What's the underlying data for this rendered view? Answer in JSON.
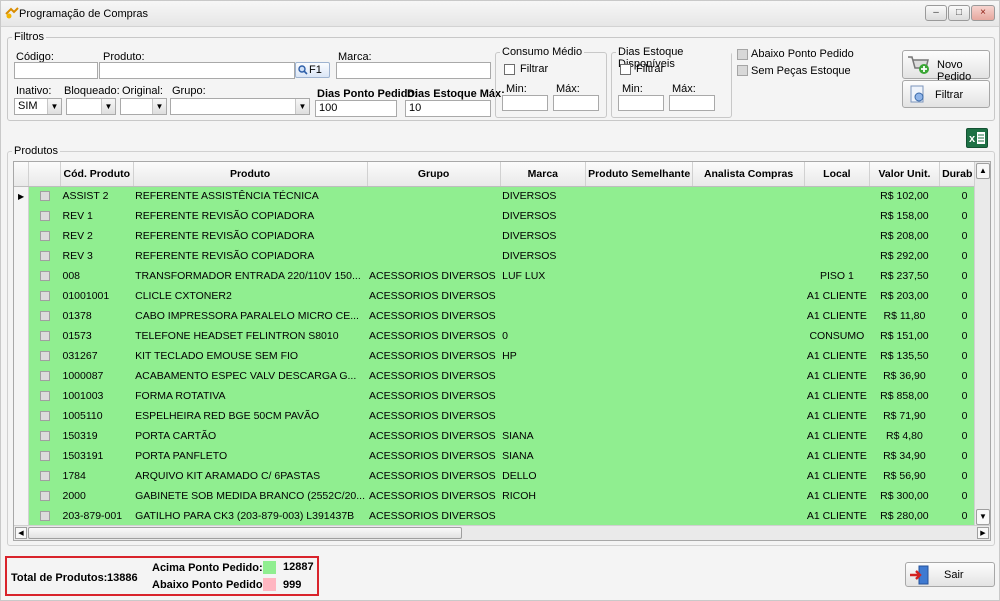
{
  "window": {
    "title": "Programação de Compras",
    "min": "–",
    "max": "□",
    "close": "×"
  },
  "filtros": {
    "legend": "Filtros",
    "codigo_label": "Código:",
    "produto_label": "Produto:",
    "marca_label": "Marca:",
    "f1_label": "F1",
    "inativo_label": "Inativo:",
    "inativo_value": "SIM",
    "bloqueado_label": "Bloqueado:",
    "original_label": "Original:",
    "grupo_label": "Grupo:",
    "dias_ponto_label": "Dias Ponto Pedido:",
    "dias_ponto_value": "100",
    "dias_estoque_label": "Dias Estoque Máx:",
    "dias_estoque_value": "10",
    "consumo_legend": "Consumo Médio",
    "consumo_filtrar": "Filtrar",
    "consumo_min": "Min:",
    "consumo_max": "Máx:",
    "dias_disp_legend": "Dias Estoque Disponíveis",
    "dias_disp_filtrar": "Filtrar",
    "dias_disp_min": "Min:",
    "dias_disp_max": "Máx:",
    "abaixo_ponto": "Abaixo Ponto Pedido",
    "sem_pecas": "Sem Peças Estoque"
  },
  "buttons": {
    "novo_pedido": "Novo Pedido",
    "filtrar": "Filtrar",
    "sair": "Sair",
    "excel": "x"
  },
  "produtos": {
    "legend": "Produtos",
    "columns": [
      "Cód. Produto",
      "Produto",
      "Grupo",
      "Marca",
      "Produto Semelhante",
      "Analista Compras",
      "Local",
      "Valor Unit.",
      "Durab"
    ],
    "rows": [
      [
        "ASSIST 2",
        "REFERENTE ASSISTÊNCIA TÉCNICA",
        "",
        "DIVERSOS",
        "",
        "",
        "",
        "R$ 102,00",
        "0"
      ],
      [
        "REV 1",
        "REFERENTE REVISÃO COPIADORA",
        "",
        "DIVERSOS",
        "",
        "",
        "",
        "R$ 158,00",
        "0"
      ],
      [
        "REV 2",
        "REFERENTE REVISÃO COPIADORA",
        "",
        "DIVERSOS",
        "",
        "",
        "",
        "R$ 208,00",
        "0"
      ],
      [
        "REV 3",
        "REFERENTE REVISÃO COPIADORA",
        "",
        "DIVERSOS",
        "",
        "",
        "",
        "R$ 292,00",
        "0"
      ],
      [
        "008",
        "TRANSFORMADOR ENTRADA 220/110V 150...",
        "ACESSORIOS DIVERSOS",
        "LUF LUX",
        "",
        "",
        "PISO 1",
        "R$ 237,50",
        "0"
      ],
      [
        "01001001",
        "CLICLE CXTONER2",
        "ACESSORIOS DIVERSOS",
        "",
        "",
        "",
        "A1 CLIENTE",
        "R$ 203,00",
        "0"
      ],
      [
        "01378",
        "CABO IMPRESSORA PARALELO MICRO CE...",
        "ACESSORIOS DIVERSOS",
        "",
        "",
        "",
        "A1 CLIENTE",
        "R$ 11,80",
        "0"
      ],
      [
        "01573",
        "TELEFONE HEADSET FELINTRON S8010",
        "ACESSORIOS DIVERSOS",
        "0",
        "",
        "",
        "CONSUMO",
        "R$ 151,00",
        "0"
      ],
      [
        "031267",
        "KIT TECLADO EMOUSE SEM FIO",
        "ACESSORIOS DIVERSOS",
        "HP",
        "",
        "",
        "A1 CLIENTE",
        "R$ 135,50",
        "0"
      ],
      [
        "1000087",
        "ACABAMENTO ESPEC VALV DESCARGA G...",
        "ACESSORIOS DIVERSOS",
        "",
        "",
        "",
        "A1 CLIENTE",
        "R$ 36,90",
        "0"
      ],
      [
        "1001003",
        "FORMA ROTATIVA",
        "ACESSORIOS DIVERSOS",
        "",
        "",
        "",
        "A1 CLIENTE",
        "R$ 858,00",
        "0"
      ],
      [
        "1005110",
        "ESPELHEIRA RED BGE 50CM PAVÃO",
        "ACESSORIOS DIVERSOS",
        "",
        "",
        "",
        "A1 CLIENTE",
        "R$ 71,90",
        "0"
      ],
      [
        "150319",
        "PORTA CARTÃO",
        "ACESSORIOS DIVERSOS",
        "SIANA",
        "",
        "",
        "A1 CLIENTE",
        "R$ 4,80",
        "0"
      ],
      [
        "1503191",
        "PORTA PANFLETO",
        "ACESSORIOS DIVERSOS",
        "SIANA",
        "",
        "",
        "A1 CLIENTE",
        "R$ 34,90",
        "0"
      ],
      [
        "1784",
        "ARQUIVO KIT ARAMADO C/ 6PASTAS",
        "ACESSORIOS DIVERSOS",
        "DELLO",
        "",
        "",
        "A1 CLIENTE",
        "R$ 56,90",
        "0"
      ],
      [
        "2000",
        "GABINETE SOB MEDIDA BRANCO (2552C/20...",
        "ACESSORIOS DIVERSOS",
        "RICOH",
        "",
        "",
        "A1 CLIENTE",
        "R$ 300,00",
        "0"
      ],
      [
        "203-879-001",
        "GATILHO PARA CK3 (203-879-003) L391437B",
        "ACESSORIOS DIVERSOS",
        "",
        "",
        "",
        "A1 CLIENTE",
        "R$ 280,00",
        "0"
      ]
    ]
  },
  "totals": {
    "total_label": "Total de Produtos:",
    "total_value": "13886",
    "acima_label": "Acima Ponto Pedido:",
    "acima_value": "12887",
    "abaixo_label": "Abaixo Ponto Pedido:",
    "abaixo_value": "999",
    "acima_color": "#90ee90",
    "abaixo_color": "#ffb6c1"
  }
}
